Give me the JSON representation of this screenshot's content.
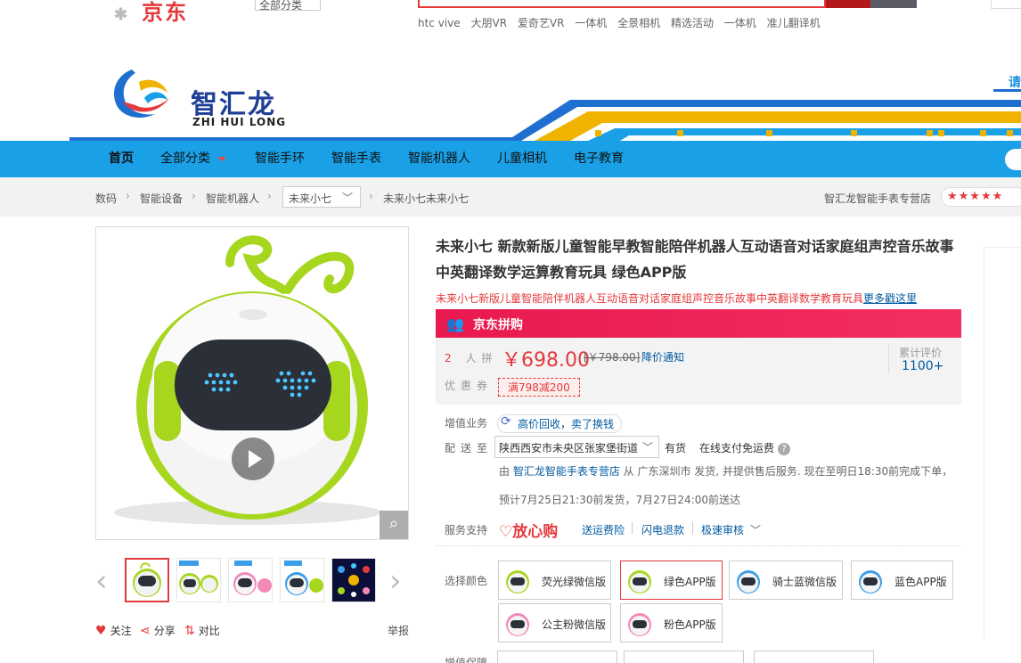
{
  "top": {
    "logo_text": "京东",
    "category_select": "全部分类",
    "hotwords": [
      "htc vive",
      "大朋VR",
      "爱奇艺VR",
      "一体机",
      "全景相机",
      "精选活动",
      "一体机",
      "准儿翻译机"
    ]
  },
  "banner": {
    "shop_name": "智汇龙",
    "shop_pinyin": "ZHI HUI LONG",
    "right_char": "请"
  },
  "nav": {
    "items": [
      "首页",
      "全部分类",
      "智能手环",
      "智能手表",
      "智能机器人",
      "儿童相机",
      "电子教育"
    ]
  },
  "breadcrumb": {
    "items": [
      "数码",
      "智能设备",
      "智能机器人"
    ],
    "select_value": "未来小七",
    "current": "未来小七未来小七",
    "store_name": "智汇龙智能手表专营店",
    "stars": "★★★★★"
  },
  "gallery": {
    "actions": {
      "follow": "关注",
      "share": "分享",
      "compare": "对比"
    },
    "report": "举报",
    "prev_icon": "chevron-left-icon",
    "next_icon": "chevron-right-icon"
  },
  "product": {
    "title": "未来小七 新款新版儿童智能早教智能陪伴机器人互动语音对话家庭组声控音乐故事中英翻译数学运算教育玩具 绿色APP版",
    "subtitle": "未来小七新版儿童智能陪伴机器人互动语音对话家庭组声控音乐故事中英翻译数学教育玩具",
    "subtitle_link": "更多戳这里",
    "pin_label": "京东拼购",
    "group": {
      "count": "2",
      "unit": "人拼"
    },
    "price": "￥698.00",
    "original_price": "[￥798.00]",
    "price_notify": "降价通知",
    "coupon_label": "优惠券",
    "coupon": "满798减200",
    "review_label": "累计评价",
    "review_count": "1100+"
  },
  "service": {
    "addon_label": "增值业务",
    "tradein": "高价回收，卖了换钱",
    "delivery_label": "配送至",
    "address": "陕西西安市未央区张家堡街道",
    "stock": "有货",
    "pay_note": "在线支付免运费",
    "ship_prefix": "由 ",
    "ship_store": "智汇龙智能手表专营店",
    "ship_suffix": " 从 广东深圳市 发货, 并提供售后服务. 现在至明日18:30前完成下单，",
    "eta": "预计7月25日21:30前发货，7月27日24:00前送达",
    "support_label": "服务支持",
    "fangxingou": "放心购",
    "links": [
      "送运费险",
      "闪电退款",
      "极速审核"
    ]
  },
  "colors": {
    "label": "选择颜色",
    "options": [
      {
        "label": "荧光绿微信版",
        "tint": "#a6d61e"
      },
      {
        "label": "绿色APP版",
        "tint": "#a6d61e"
      },
      {
        "label": "骑士蓝微信版",
        "tint": "#3a9ee8"
      },
      {
        "label": "蓝色APP版",
        "tint": "#3a9ee8"
      },
      {
        "label": "公主粉微信版",
        "tint": "#f28ab8"
      },
      {
        "label": "粉色APP版",
        "tint": "#f28ab8"
      }
    ],
    "selected_index": 1
  },
  "bottom": {
    "label": "增值保障"
  },
  "colors_theme": {
    "jd_red": "#e4393c",
    "nav_blue": "#1aa0e6",
    "link_blue": "#005aa0",
    "pin_pink": "#e8194e"
  }
}
